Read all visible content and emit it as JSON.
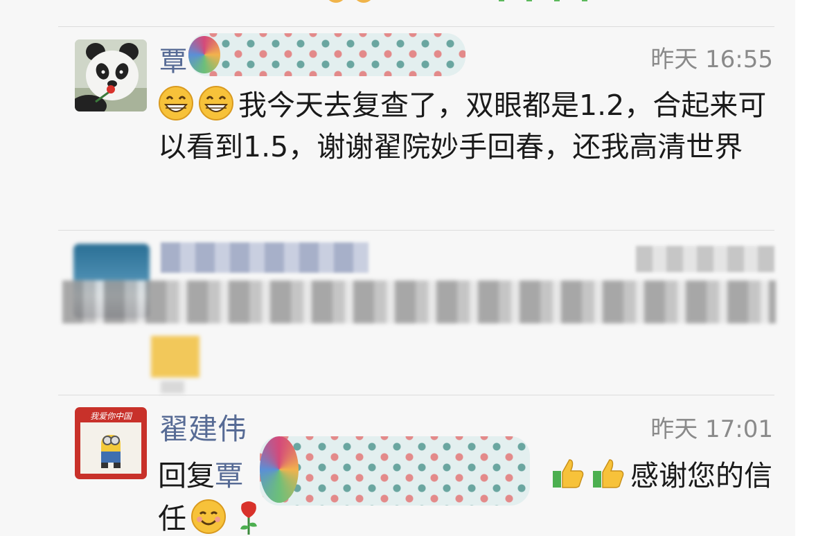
{
  "comments": [
    {
      "name_visible": "覃",
      "time": "昨天 16:55",
      "text": "我今天去复查了，双眼都是1.2，合起来可以看到1.5，谢谢翟院妙手回春，还我高清世界",
      "leading_emojis": [
        "grinning-face",
        "grinning-face"
      ],
      "avatar": "panda-avatar"
    },
    {
      "name_visible": "",
      "time": "",
      "text": "",
      "blurred": true
    },
    {
      "name_visible": "翟建伟",
      "time": "昨天 17:01",
      "reply_prefix": "回复",
      "reply_to_visible": "覃",
      "colon": "：",
      "text_after": "感谢您的信任",
      "avatar_banner": "我爱你中国"
    }
  ],
  "colors": {
    "name_blue": "#576b95",
    "time_gray": "#8a8a8a",
    "divider": "#dcdcdc",
    "background": "#f7f7f7"
  }
}
